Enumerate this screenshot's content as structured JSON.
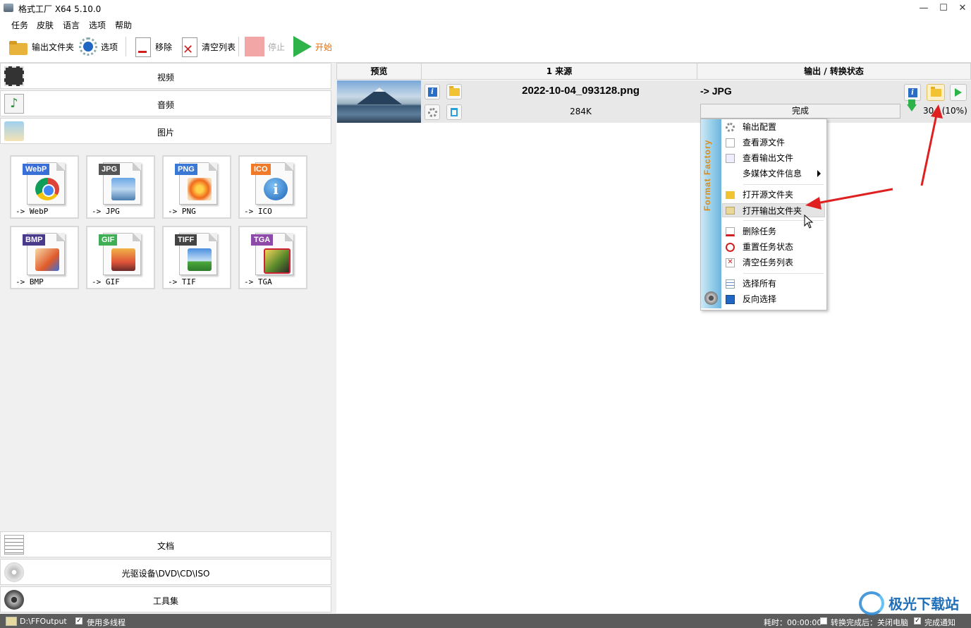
{
  "window": {
    "title": "格式工厂 X64 5.10.0",
    "minimize": "—",
    "maximize": "☐",
    "close": "✕"
  },
  "menu": [
    "任务",
    "皮肤",
    "语言",
    "选项",
    "帮助"
  ],
  "toolbar": {
    "output_folder": "输出文件夹",
    "options": "选项",
    "remove": "移除",
    "clear_list": "清空列表",
    "stop": "停止",
    "start": "开始"
  },
  "categories": {
    "video": "视频",
    "audio": "音频",
    "image": "图片",
    "document": "文档",
    "disc": "光驱设备\\DVD\\CD\\ISO",
    "tools": "工具集"
  },
  "formats": [
    {
      "tag": "WebP",
      "label": "-> WebP",
      "color": "#3a6fd8"
    },
    {
      "tag": "JPG",
      "label": "-> JPG",
      "color": "#555555"
    },
    {
      "tag": "PNG",
      "label": "-> PNG",
      "color": "#3a78d6"
    },
    {
      "tag": "ICO",
      "label": "-> ICO",
      "color": "#f07a2a"
    },
    {
      "tag": "BMP",
      "label": "-> BMP",
      "color": "#4a3a8c"
    },
    {
      "tag": "GIF",
      "label": "-> GIF",
      "color": "#3fae55"
    },
    {
      "tag": "TIFF",
      "label": "-> TIF",
      "color": "#444444"
    },
    {
      "tag": "TGA",
      "label": "-> TGA",
      "color": "#8e4aa8"
    }
  ],
  "table": {
    "headers": {
      "preview": "预览",
      "source": "1 来源",
      "output": "输出 / 转换状态"
    },
    "row": {
      "filename": "2022-10-04_093128.png",
      "size": "284K",
      "target": "-> JPG",
      "status": "完成",
      "ratio": "30   (10%)"
    }
  },
  "context_menu": {
    "brand": "Format Factory",
    "items": [
      "输出配置",
      "查看源文件",
      "查看输出文件",
      "多媒体文件信息",
      "打开源文件夹",
      "打开输出文件夹",
      "删除任务",
      "重置任务状态",
      "清空任务列表",
      "选择所有",
      "反向选择"
    ]
  },
  "statusbar": {
    "path": "D:\\FFOutput",
    "multithread": "使用多线程",
    "time": "耗时：00:00:00",
    "after": "转换完成后：关闭电脑",
    "notify": "完成通知"
  },
  "watermark": "极光下载站",
  "colors": {
    "accent_green": "#2db34a",
    "arrow_red": "#e02020",
    "stop_disabled": "#f3a6a6"
  }
}
